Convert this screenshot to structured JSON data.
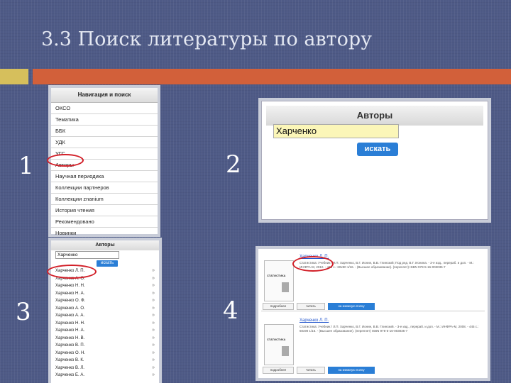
{
  "slide": {
    "title": "3.3 Поиск литературы по автору",
    "step_numbers": [
      "1",
      "2",
      "3",
      "4"
    ],
    "colors": {
      "background": "#4e5a86",
      "accent_yellow": "#d6bf5c",
      "accent_orange": "#d2603a",
      "highlight_circle": "#d21f28",
      "button_blue": "#2a7ed6"
    }
  },
  "nav": {
    "header": "Навигация и поиск",
    "items": [
      "ОКСО",
      "Тематика",
      "ББК",
      "УДК",
      "УГС",
      "Авторы",
      "Научная периодика",
      "Коллекции партнеров",
      "Коллекции znanium",
      "История чтения",
      "Рекомендовано",
      "Новинки"
    ],
    "highlighted": "Авторы"
  },
  "authors_search": {
    "header": "Авторы",
    "input_value": "Харченко",
    "button": "искать"
  },
  "authors_list": {
    "header": "Авторы",
    "input_value": "Харченко",
    "button": "искать",
    "arrow": "»",
    "items": [
      "Харченко Л. П.",
      "Харченко А. О.",
      "Харченко Н. Н.",
      "Харченко Н. А.",
      "Харченко О. Ф.",
      "Харченко А. О.",
      "Харченко А. А.",
      "Харченко Н. Н.",
      "Харченко Н. А.",
      "Харченко Н. В.",
      "Харченко В. П.",
      "Харченко О. Н.",
      "Харченко В. К.",
      "Харченко В. Л.",
      "Харченко Е. А."
    ]
  },
  "results": [
    {
      "author": "Харченко Л. П.",
      "cover": "СТАТИСТИКА",
      "description": "Статистика: Учебник / Л.П. Харченко, В.Г. Ионин, В.В. Глинский; Под ред. В.Г. Ионина. - 3-e изд., перераб. и доп. - М.: ИНФРА-М, 2010. - 445 с.: 60x90 1/16. - (Высшее образование). (переплет) ISBN 978-5-16-003035-7",
      "buttons": [
        "подробнее",
        "читать",
        "на книжную полку"
      ]
    },
    {
      "author": "Харченко Л. П.",
      "cover": "СТАТИСТИКА",
      "description": "Статистика: Учебник / Л.П. Харченко, В.Г. Ионин, В.В. Глинский. - 3-e изд., перераб. и доп. - М.: ИНФРА-М, 2008. - 445 с.: 60x90 1/16. - (Высшее образование). (переплет) ISBN 978-5-16-003035-7",
      "buttons": [
        "подробнее",
        "читать",
        "на книжную полку"
      ]
    }
  ]
}
